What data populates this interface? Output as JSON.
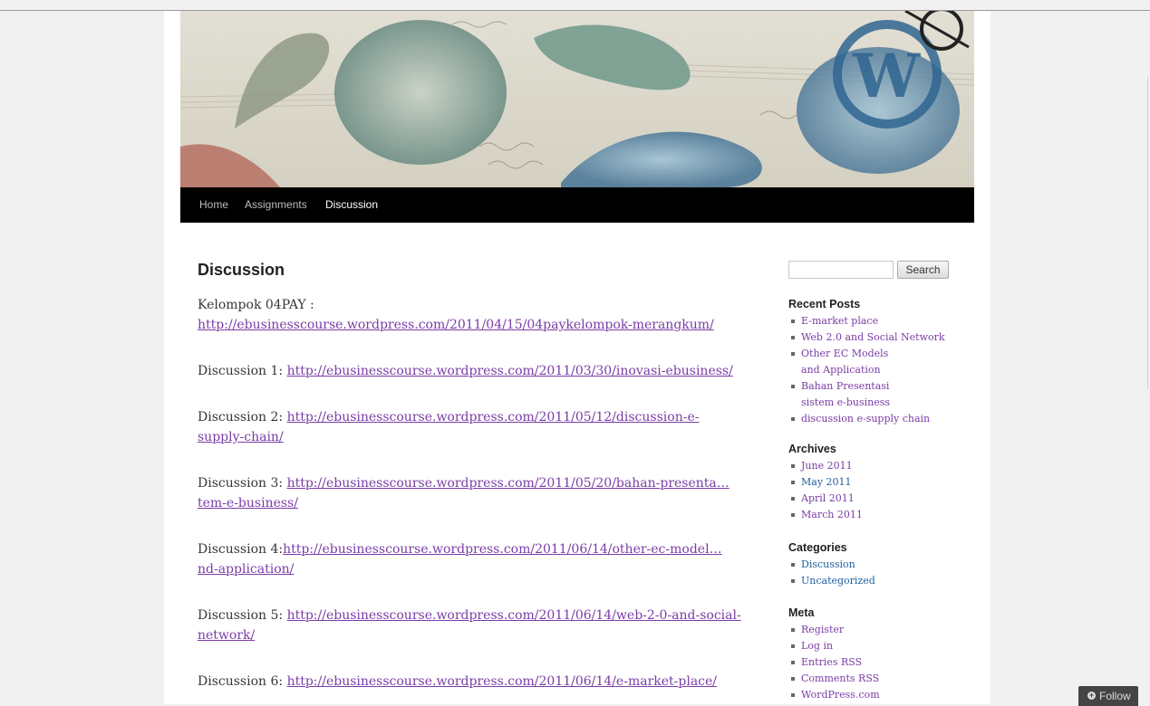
{
  "nav": {
    "items": [
      {
        "label": "Home"
      },
      {
        "label": "Assignments"
      },
      {
        "label": "Discussion"
      }
    ],
    "active": "Discussion"
  },
  "page": {
    "title": "Discussion",
    "entries": [
      {
        "prefix": "Kelompok 04PAY : ",
        "link": "http://ebusinesscourse.wordpress.com/2011/04/15/04paykelompok-merangkum/"
      },
      {
        "prefix": "Discussion 1: ",
        "link": "http://ebusinesscourse.wordpress.com/2011/03/30/inovasi-ebusiness/"
      },
      {
        "prefix": "Discussion 2: ",
        "link": "http://ebusinesscourse.wordpress.com/2011/05/12/discussion-e-supply-chain/"
      },
      {
        "prefix": "Discussion 3: ",
        "link": "http://ebusinesscourse.wordpress.com/2011/05/20/bahan-presenta…tem-e-business/"
      },
      {
        "prefix": "Discussion 4:",
        "link": "http://ebusinesscourse.wordpress.com/2011/06/14/other-ec-model…nd-application/"
      },
      {
        "prefix": "Discussion 5: ",
        "link": "http://ebusinesscourse.wordpress.com/2011/06/14/web-2-0-and-social-network/"
      },
      {
        "prefix": "Discussion 6: ",
        "link": "http://ebusinesscourse.wordpress.com/2011/06/14/e-market-place/"
      }
    ]
  },
  "sidebar": {
    "search": {
      "value": "",
      "button": "Search"
    },
    "recent_posts": {
      "title": "Recent Posts",
      "items": [
        {
          "label": "E-market place"
        },
        {
          "label": "Web 2.0 and Social Network"
        },
        {
          "line1": "Other EC Models",
          "line2": "and Application"
        },
        {
          "line1": "Bahan Presentasi",
          "line2": "sistem e-business"
        },
        {
          "label": "discussion e-supply chain"
        }
      ]
    },
    "archives": {
      "title": "Archives",
      "items": [
        {
          "label": "June 2011"
        },
        {
          "label": "May 2011"
        },
        {
          "label": "April 2011"
        },
        {
          "label": "March 2011"
        }
      ]
    },
    "categories": {
      "title": "Categories",
      "items": [
        {
          "label": "Discussion"
        },
        {
          "label": "Uncategorized"
        }
      ]
    },
    "meta": {
      "title": "Meta",
      "items": [
        {
          "label": "Register"
        },
        {
          "label": "Log in"
        },
        {
          "label": "Entries RSS"
        },
        {
          "label": "Comments RSS"
        },
        {
          "label": "WordPress.com"
        }
      ]
    }
  },
  "follow": {
    "label": "Follow"
  },
  "colors": {
    "link_visited": "#7a3ca6",
    "link": "#1e5e9e",
    "nav_bg": "#000000",
    "page_bg": "#f1f1f1"
  }
}
